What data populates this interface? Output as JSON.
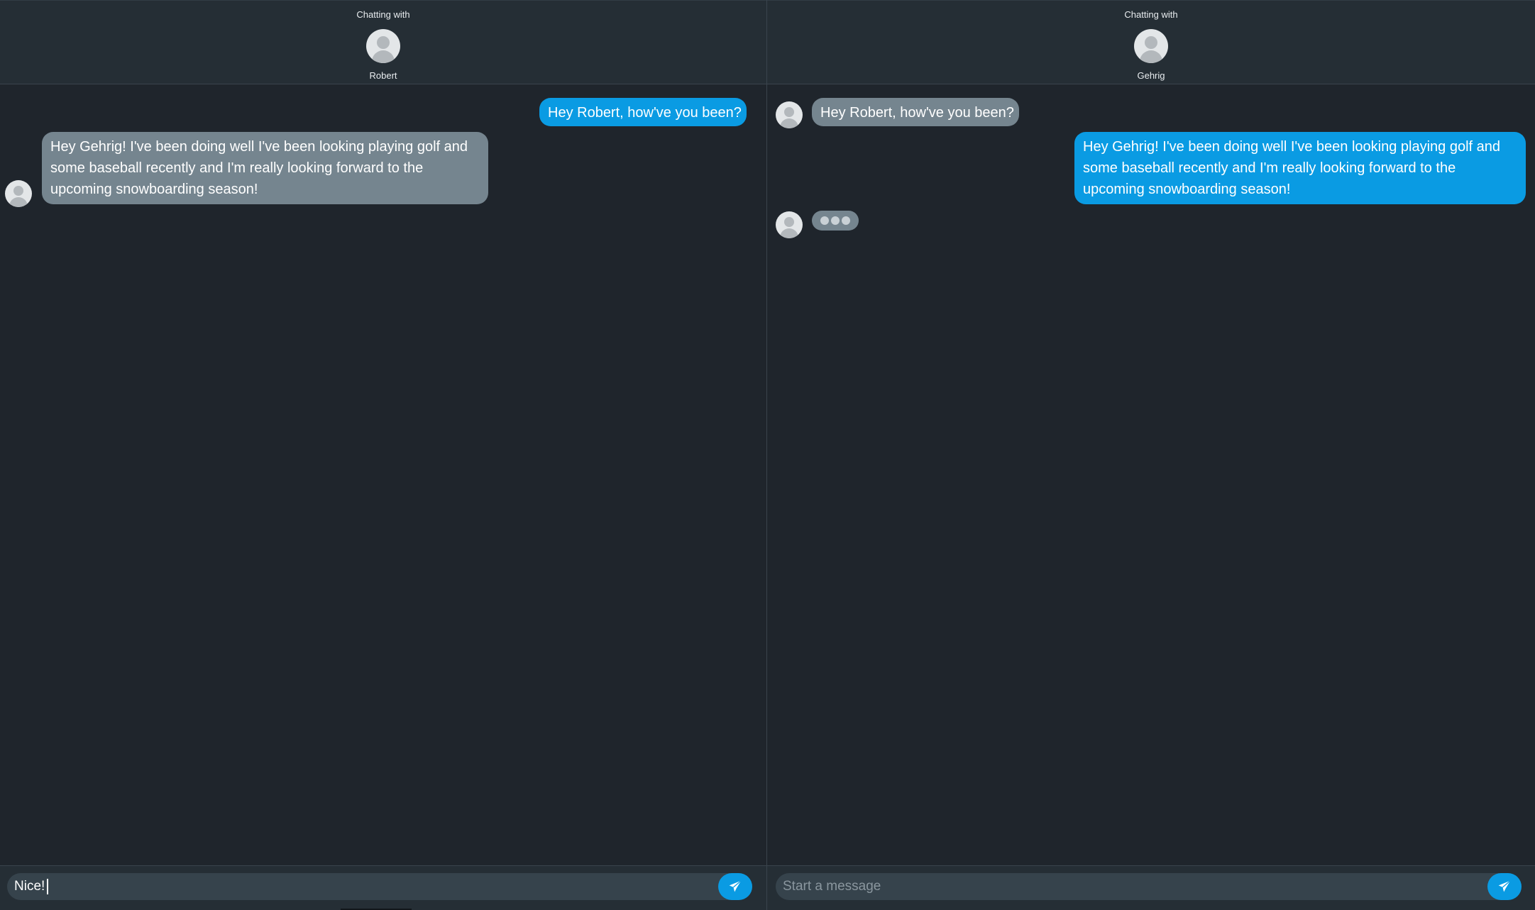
{
  "left_pane": {
    "header": {
      "caption": "Chatting with",
      "name": "Robert"
    },
    "messages": [
      {
        "direction": "out",
        "text": "Hey Robert, how've you been?"
      },
      {
        "direction": "in",
        "text": "Hey Gehrig! I've been doing well I've been looking playing golf and some baseball recently and I'm really looking forward to the upcoming snowboarding season!"
      }
    ],
    "composer": {
      "value": "Nice!",
      "placeholder": "Start a message"
    }
  },
  "right_pane": {
    "header": {
      "caption": "Chatting with",
      "name": "Gehrig"
    },
    "messages": [
      {
        "direction": "in",
        "text": "Hey Robert, how've you been?"
      },
      {
        "direction": "out",
        "text": "Hey Gehrig! I've been doing well I've been looking playing golf and some baseball recently and I'm really looking forward to the upcoming snowboarding season!"
      }
    ],
    "typing_indicator": true,
    "composer": {
      "value": "",
      "placeholder": "Start a message"
    }
  },
  "colors": {
    "background": "#1f252c",
    "header": "#252e35",
    "outgoing_bubble": "#0a9be3",
    "incoming_bubble": "#75858f",
    "send_button": "#0a9be3"
  },
  "icons": [
    "avatar-icon",
    "send-icon",
    "typing-dots-icon"
  ]
}
